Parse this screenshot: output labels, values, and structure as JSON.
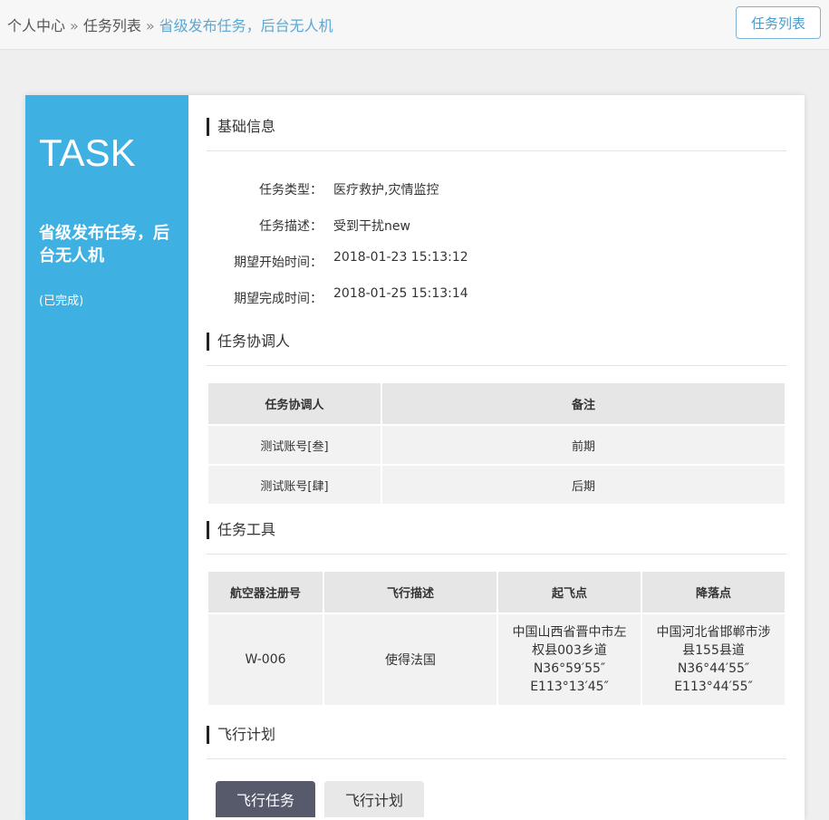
{
  "breadcrumb": {
    "items": [
      "个人中心",
      "任务列表"
    ],
    "separator": "»",
    "current": "省级发布任务，后台无人机"
  },
  "header": {
    "task_list_button": "任务列表"
  },
  "sidebar": {
    "heading": "TASK",
    "task_name": "省级发布任务，后台无人机",
    "status": "(已完成)"
  },
  "sections": {
    "basic": {
      "title": "基础信息",
      "fields": [
        {
          "label": "任务类型：",
          "value": "医疗救护,灾情监控"
        },
        {
          "label": "任务描述：",
          "value": "受到干扰new"
        },
        {
          "label": "期望开始时间：",
          "value": "2018-01-23 15:13:12"
        },
        {
          "label": "期望完成时间：",
          "value": "2018-01-25 15:13:14"
        }
      ]
    },
    "coordinators": {
      "title": "任务协调人",
      "columns": [
        "任务协调人",
        "备注"
      ],
      "rows": [
        [
          "测试账号[叁]",
          "前期"
        ],
        [
          "测试账号[肆]",
          "后期"
        ]
      ]
    },
    "tools": {
      "title": "任务工具",
      "columns": [
        "航空器注册号",
        "飞行描述",
        "起飞点",
        "降落点"
      ],
      "rows": [
        {
          "reg": "W-006",
          "desc": "使得法国",
          "takeoff": [
            "中国山西省晋中市左",
            "权县003乡道",
            "N36°59′55″",
            "E113°13′45″"
          ],
          "landing": [
            "中国河北省邯郸市涉",
            "县155县道",
            "N36°44′55″",
            "E113°44′55″"
          ]
        }
      ]
    },
    "plan": {
      "title": "飞行计划",
      "tabs": [
        {
          "label": "飞行任务",
          "active": true
        },
        {
          "label": "飞行计划",
          "active": false
        }
      ]
    }
  },
  "colors": {
    "sidebar_bg": "#3eb0e2",
    "breadcrumb_current": "#5aa8d4",
    "active_tab": "#565a6b"
  }
}
